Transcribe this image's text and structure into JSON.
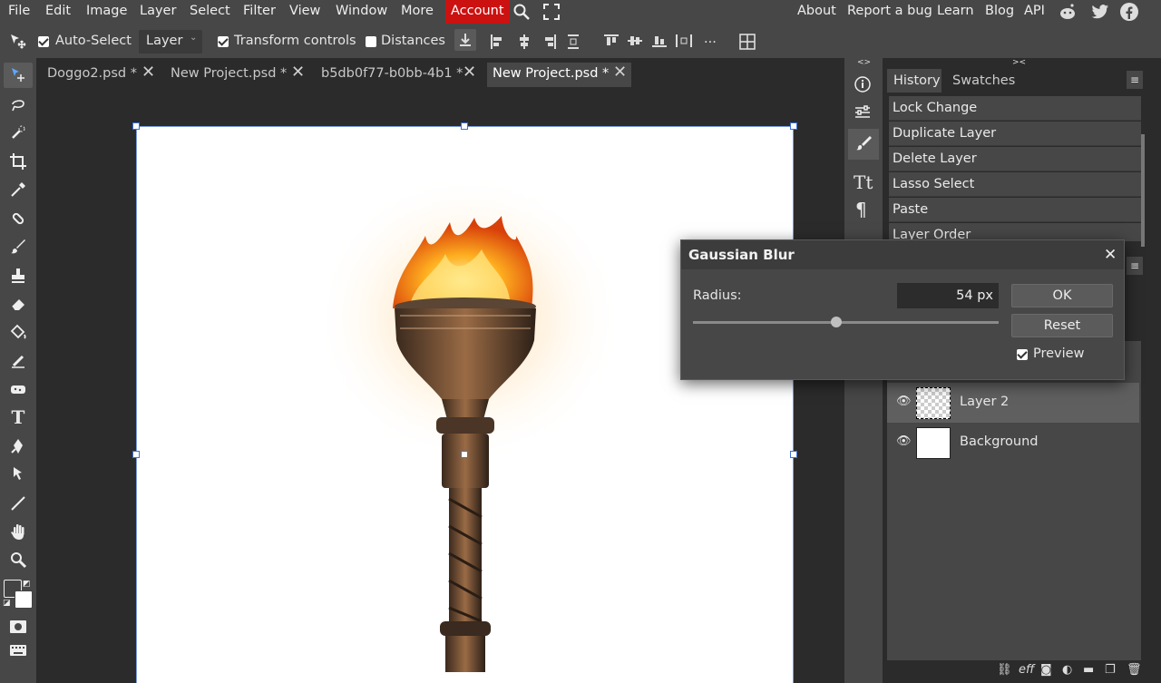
{
  "menu": {
    "items": [
      "File",
      "Edit",
      "Image",
      "Layer",
      "Select",
      "Filter",
      "View",
      "Window",
      "More",
      "Account"
    ],
    "right": [
      "About",
      "Report a bug",
      "Learn",
      "Blog",
      "API"
    ]
  },
  "options": {
    "auto_select_label": "Auto-Select",
    "auto_select_checked": true,
    "layer_select_value": "Layer",
    "transform_label": "Transform controls",
    "transform_checked": true,
    "distances_label": "Distances",
    "distances_checked": false,
    "more_label": "..."
  },
  "tabs": [
    {
      "label": "Doggo2.psd *"
    },
    {
      "label": "New Project.psd *"
    },
    {
      "label": "b5db0f77-b0bb-4b1 *"
    },
    {
      "label": "New Project.psd *"
    }
  ],
  "panel": {
    "history_tab": "History",
    "swatches_tab": "Swatches",
    "history_items": [
      "Lock Change",
      "Duplicate Layer",
      "Delete Layer",
      "Lasso Select",
      "Paste",
      "Layer Order"
    ]
  },
  "layers": [
    {
      "name": "Layer 2",
      "selected": true
    },
    {
      "name": "Background",
      "selected": false
    }
  ],
  "dialog": {
    "title": "Gaussian Blur",
    "radius_label": "Radius:",
    "radius_value": "54 px",
    "radius_slider_fraction": 0.47,
    "ok_label": "OK",
    "reset_label": "Reset",
    "preview_label": "Preview",
    "preview_checked": true
  },
  "colors": {
    "account_bg": "#cc1111",
    "selection_blue": "#3d6fd6"
  },
  "bottom_bar": {
    "eff_label": "eff"
  }
}
